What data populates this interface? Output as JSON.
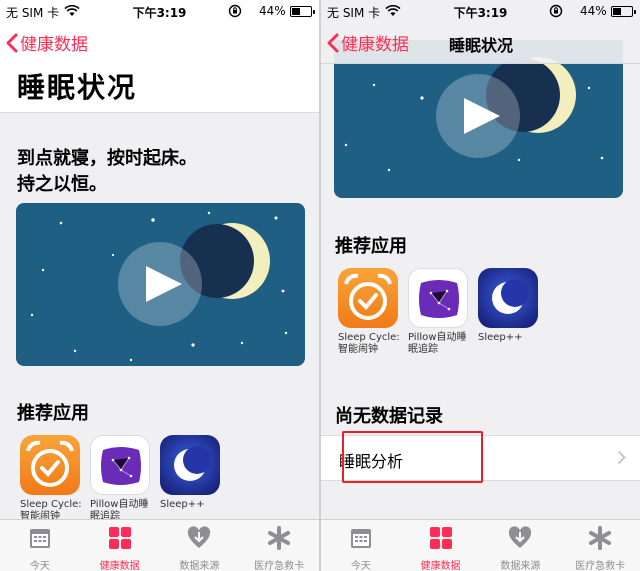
{
  "left": {
    "status": {
      "carrier": "无 SIM 卡",
      "time": "下午3:19",
      "battery_pct": "44%",
      "battery_level": 0.44
    },
    "nav": {
      "back_label": "健康数据"
    },
    "large_title": "睡眠状况",
    "intro_line1": "到点就寝，按时起床。",
    "intro_line2": "持之以恒。",
    "recommended_title": "推荐应用",
    "apps": [
      {
        "label": "Sleep Cycle:\n智能闹钟"
      },
      {
        "label": "Pillow自动睡\n眠追踪"
      },
      {
        "label": "Sleep++"
      }
    ]
  },
  "right": {
    "status": {
      "carrier": "无 SIM 卡",
      "time": "下午3:19",
      "battery_pct": "44%",
      "battery_level": 0.44
    },
    "nav": {
      "back_label": "健康数据",
      "title": "睡眠状况"
    },
    "recommended_title": "推荐应用",
    "apps": [
      {
        "label": "Sleep Cycle:\n智能闹钟"
      },
      {
        "label": "Pillow自动睡\n眠追踪"
      },
      {
        "label": "Sleep++"
      }
    ],
    "no_data_title": "尚无数据记录",
    "row_label": "睡眠分析"
  },
  "tabbar": [
    {
      "label": "今天",
      "icon": "calendar-icon"
    },
    {
      "label": "健康数据",
      "icon": "grid-icon",
      "active": true
    },
    {
      "label": "数据来源",
      "icon": "download-heart-icon"
    },
    {
      "label": "医疗急救卡",
      "icon": "asterisk-icon"
    }
  ],
  "colors": {
    "accent": "#ff2d55",
    "video_bg": "#1f5f84",
    "highlight": "#e8202a"
  }
}
